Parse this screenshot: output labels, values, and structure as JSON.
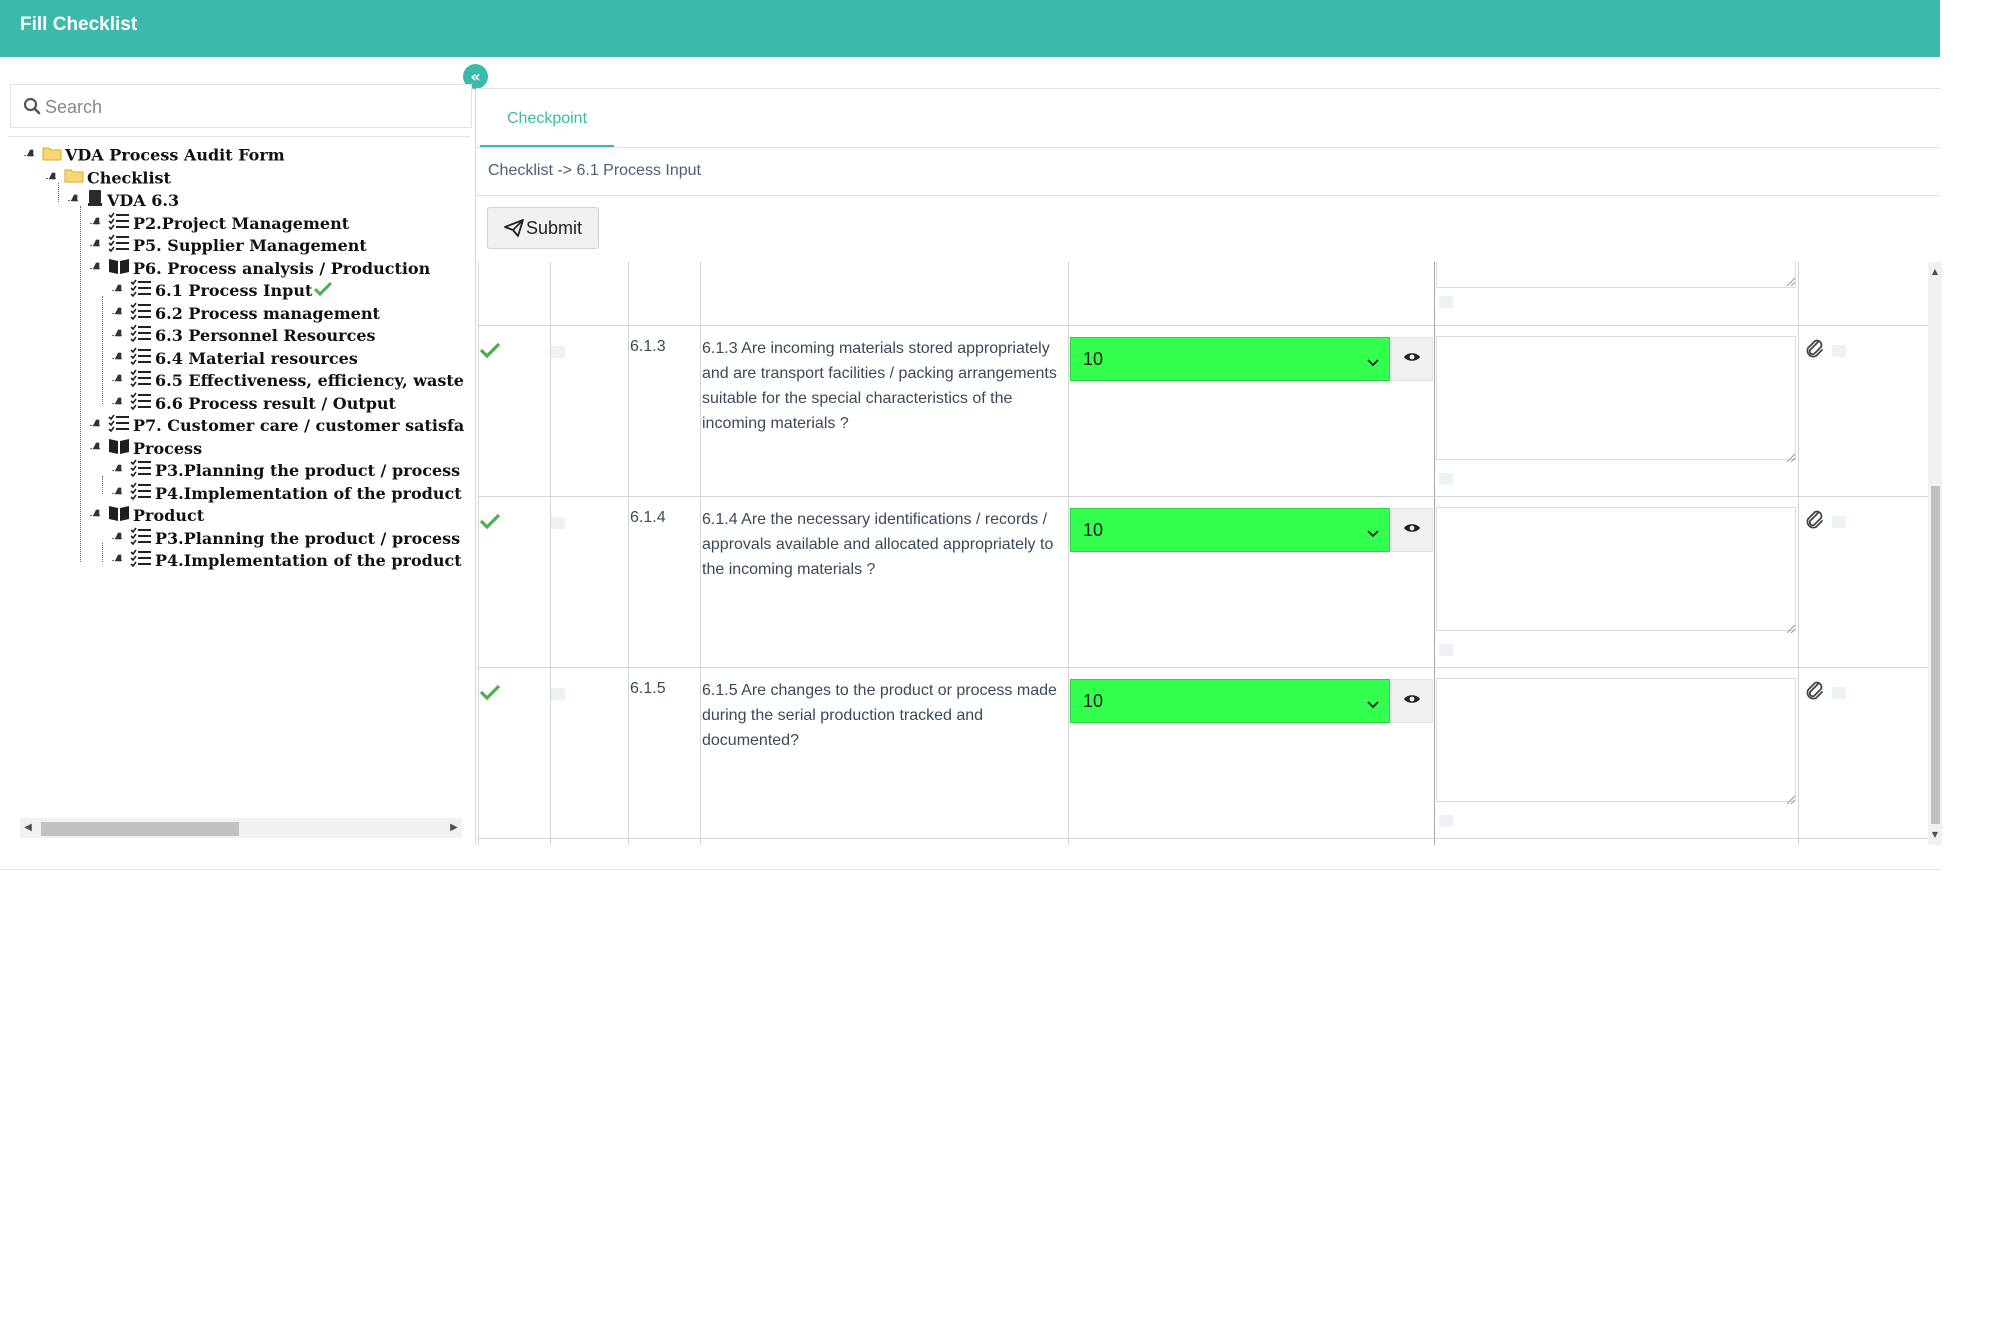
{
  "header": {
    "title": "Fill Checklist"
  },
  "sidebar": {
    "collapse_glyph": "«",
    "search_placeholder": "Search",
    "tree": [
      {
        "label": "VDA Process Audit Form",
        "icon": "folder-icon",
        "level": 0
      },
      {
        "label": "Checklist",
        "icon": "folder-icon",
        "level": 1
      },
      {
        "label": "VDA 6.3",
        "icon": "book-icon",
        "level": 2
      },
      {
        "label": "P2.Project Management",
        "icon": "checklist-icon",
        "level": 3
      },
      {
        "label": "P5. Supplier Management",
        "icon": "checklist-icon",
        "level": 3
      },
      {
        "label": "P6. Process analysis / Production",
        "icon": "open-book-icon",
        "level": 3
      },
      {
        "label": "6.1 Process Input",
        "icon": "checklist-icon",
        "level": 4,
        "checked": true
      },
      {
        "label": "6.2 Process management",
        "icon": "checklist-icon",
        "level": 4
      },
      {
        "label": "6.3 Personnel Resources",
        "icon": "checklist-icon",
        "level": 4
      },
      {
        "label": "6.4 Material resources",
        "icon": "checklist-icon",
        "level": 4
      },
      {
        "label": "6.5 Effectiveness, efficiency, waste",
        "icon": "checklist-icon",
        "level": 4
      },
      {
        "label": "6.6 Process result / Output",
        "icon": "checklist-icon",
        "level": 4
      },
      {
        "label": "P7. Customer care / customer satisfa",
        "icon": "checklist-icon",
        "level": 3
      },
      {
        "label": "Process",
        "icon": "open-book-icon",
        "level": 3
      },
      {
        "label": "P3.Planning the product / process",
        "icon": "checklist-icon",
        "level": 4
      },
      {
        "label": "P4.Implementation of the product",
        "icon": "checklist-icon",
        "level": 4
      },
      {
        "label": "Product",
        "icon": "open-book-icon",
        "level": 3
      },
      {
        "label": "P3.Planning the product / process",
        "icon": "checklist-icon",
        "level": 4
      },
      {
        "label": "P4.Implementation of the product",
        "icon": "checklist-icon",
        "level": 4
      }
    ]
  },
  "main": {
    "tabs": [
      {
        "label": "Checkpoint",
        "active": true
      }
    ],
    "breadcrumb": "Checklist -> 6.1 Process Input",
    "submit_label": "Submit",
    "rows": [
      {
        "code": "6.1.3",
        "question": "6.1.3 Are incoming materials stored appropriately and are transport facilities / packing arrangements suitable for the special characteristics of the incoming materials ?",
        "score": "10",
        "remark": ""
      },
      {
        "code": "6.1.4",
        "question": "6.1.4 Are the necessary identifications / records / approvals available and allocated appropriately to the incoming materials ?",
        "score": "10",
        "remark": ""
      },
      {
        "code": "6.1.5",
        "question": "6.1.5 Are changes to the product or process made during the serial production tracked and documented?",
        "score": "10",
        "remark": ""
      }
    ]
  },
  "colors": {
    "brand": "#3bb9aa",
    "score_ok": "#33ff4f",
    "check": "#4caf50"
  }
}
